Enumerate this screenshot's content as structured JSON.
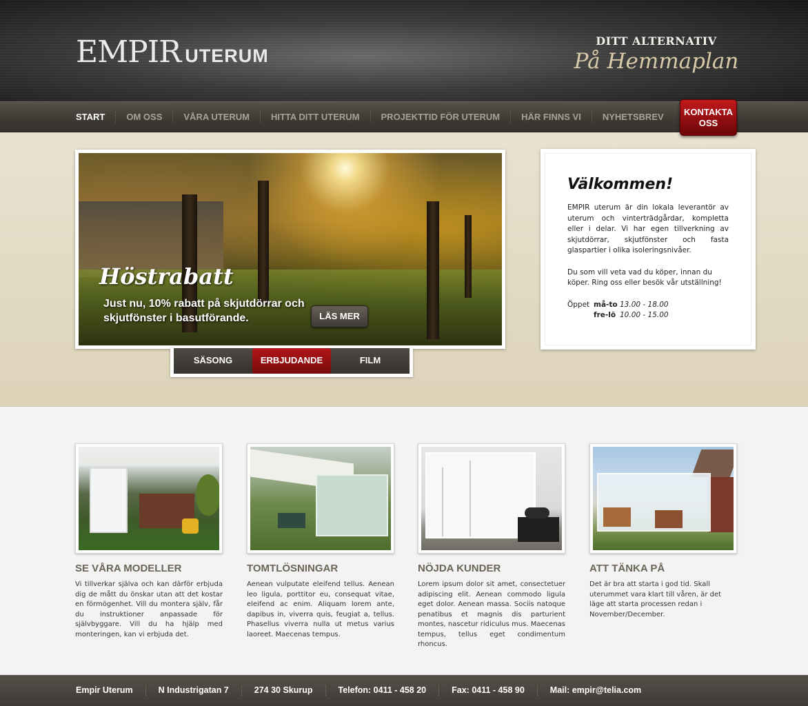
{
  "header": {
    "logo_main": "EMPIR",
    "logo_sub": "UTERUM",
    "slogan_top": "DITT ALTERNATIV",
    "slogan_bottom": "På Hemmaplan"
  },
  "nav": {
    "items": [
      "START",
      "OM OSS",
      "VÅRA UTERUM",
      "HITTA DITT UTERUM",
      "PROJEKTTID FÖR UTERUM",
      "HÄR FINNS VI",
      "NYHETSBREV"
    ],
    "active": "START",
    "contact_line1": "KONTAKTA",
    "contact_line2": "OSS"
  },
  "slider": {
    "headline": "Höstrabatt",
    "text": "Just nu, 10% rabatt på skjutdörrar och skjutfönster i basutförande.",
    "button": "LÄS MER",
    "tabs": [
      "SÄSONG",
      "ERBJUDANDE",
      "FILM"
    ],
    "active_tab": "ERBJUDANDE"
  },
  "welcome": {
    "title": "Välkommen!",
    "p1": "EMPIR uterum är din lokala leverantör av uterum och vinterträdgårdar, kompletta eller i delar. Vi har egen tillverkning av skjutdörrar, skjutfönster och fasta glaspartier i olika isoleringsnivåer.",
    "p2": "Du som vill veta vad du köper, innan du köper. Ring oss eller besök vår utställning!",
    "hours_label": "Öppet",
    "hours": [
      {
        "day": "må-to",
        "time": "13.00 - 18.00"
      },
      {
        "day": "fre-lö",
        "time": "10.00 - 15.00"
      }
    ]
  },
  "features": [
    {
      "title": "SE VÅRA MODELLER",
      "text": "Vi tillverkar själva och kan därför erbjuda dig de mått du önskar utan att det kostar en förmögenhet. Vill du montera själv, får du instruktioner anpassade för självbyggare. Vill du ha hjälp med monteringen, kan vi erbjuda det."
    },
    {
      "title": "TOMTLÖSNINGAR",
      "text": "Aenean vulputate eleifend tellus. Aenean leo ligula, porttitor eu, consequat vitae, eleifend ac enim. Aliquam lorem ante, dapibus in, viverra quis, feugiat a, tellus. Phasellus viverra nulla ut metus varius laoreet. Maecenas tempus."
    },
    {
      "title": "NÖJDA KUNDER",
      "text": "Lorem ipsum dolor sit amet, consectetuer adipiscing elit. Aenean commodo ligula eget dolor. Aenean massa. Sociis natoque penatibus et magnis dis parturient montes, nascetur ridiculus mus. Maecenas tempus, tellus eget condimentum rhoncus."
    },
    {
      "title": "ATT TÄNKA PÅ",
      "text": "Det är bra att starta i god tid. Skall uterummet vara klart till våren, är det läge att starta processen redan i November/December."
    }
  ],
  "footer": {
    "items": [
      "Empir Uterum",
      "N Industrigatan 7",
      "274 30 Skurup",
      "Telefon: 0411 - 458 20",
      "Fax: 0411 - 458 90",
      "Mail: empir@telia.com"
    ]
  }
}
